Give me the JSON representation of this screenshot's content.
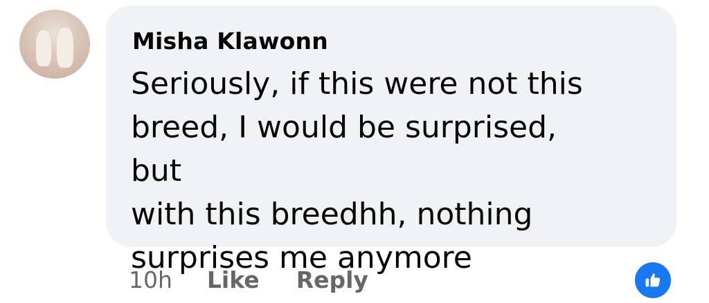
{
  "comment": {
    "author": "Misha Klawonn",
    "text": "Seriously, if this were not this breed, I would be surprised, but with this breedhh, nothing surprises me anymore",
    "lines": [
      "Seriously, if this were not this",
      "breed, I would be surprised, but",
      "with this breedhh, nothing",
      "surprises me anymore"
    ]
  },
  "actions": {
    "time": "10h",
    "like": "Like",
    "reply": "Reply"
  },
  "reaction": {
    "icon": "thumbs-up-icon",
    "color": "#1877f2"
  },
  "colors": {
    "bubble": "#f0f2f5",
    "text": "#050505",
    "secondary": "#65676b"
  }
}
